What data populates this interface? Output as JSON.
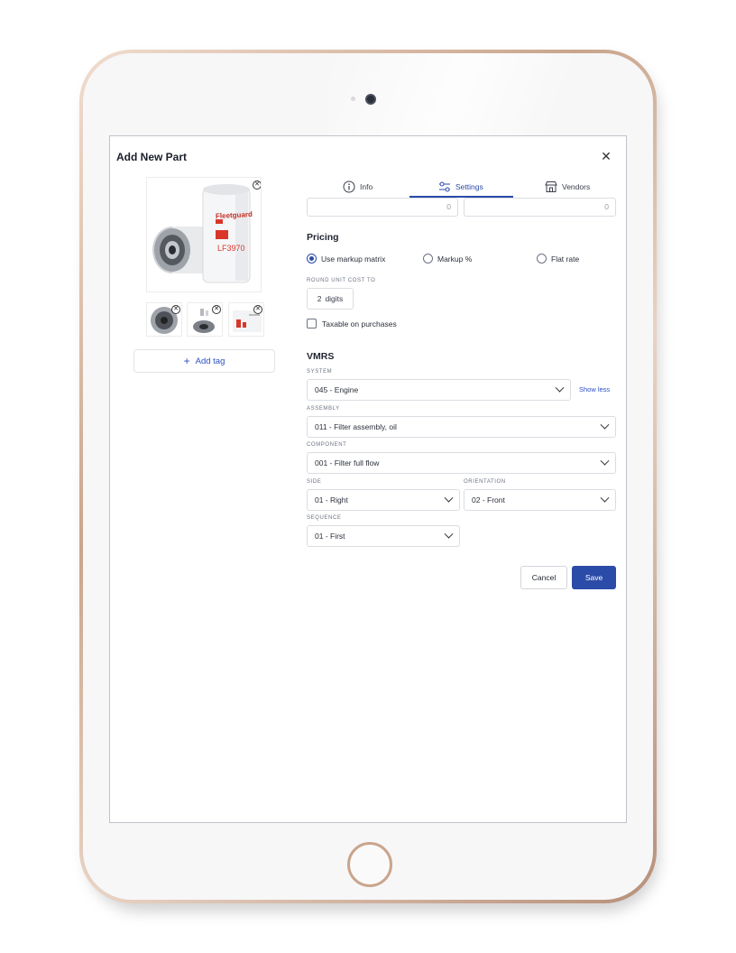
{
  "modal": {
    "title": "Add New Part",
    "close_icon": "close-icon"
  },
  "images": {
    "main_brand": "Fleetguard",
    "main_part_number": "LF3970",
    "add_tag_label": "Add tag"
  },
  "tabs": [
    {
      "label": "Info",
      "icon": "info-icon",
      "active": false
    },
    {
      "label": "Settings",
      "icon": "sliders-icon",
      "active": true
    },
    {
      "label": "Vendors",
      "icon": "store-icon",
      "active": false
    }
  ],
  "quantities": {
    "left_value": "0",
    "right_value": "0"
  },
  "pricing": {
    "title": "Pricing",
    "options": [
      "Use markup matrix",
      "Markup %",
      "Flat rate"
    ],
    "selected": "Use markup matrix",
    "round_label": "ROUND UNIT COST TO",
    "round_value": "2",
    "round_unit": "digits",
    "taxable_label": "Taxable on purchases",
    "taxable_checked": false
  },
  "vmrs": {
    "title": "VMRS",
    "system_label": "SYSTEM",
    "system_value": "045 - Engine",
    "show_less": "Show less",
    "assembly_label": "ASSEMBLY",
    "assembly_value": "011 - Filter assembly, oil",
    "component_label": "COMPONENT",
    "component_value": "001 - Filter full flow",
    "side_label": "SIDE",
    "side_value": "01 - Right",
    "orientation_label": "ORIENTATION",
    "orientation_value": "02 - Front",
    "sequence_label": "SEQUENCE",
    "sequence_value": "01 - First"
  },
  "actions": {
    "cancel": "Cancel",
    "save": "Save"
  },
  "colors": {
    "accent": "#2b4ba8",
    "link": "#2d4fc4",
    "device_frame": "#c9a58c"
  }
}
